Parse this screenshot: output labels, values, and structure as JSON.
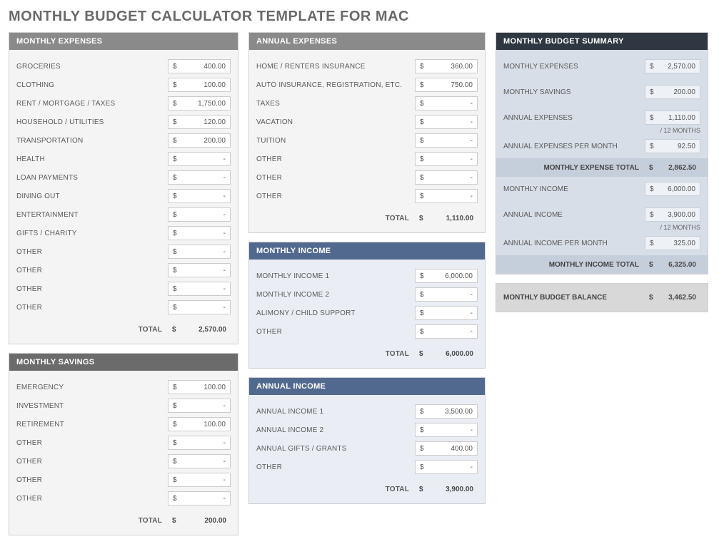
{
  "title": "MONTHLY BUDGET CALCULATOR TEMPLATE FOR MAC",
  "currency": "$",
  "dash": "-",
  "headers": {
    "monthly_expenses": "MONTHLY EXPENSES",
    "monthly_savings": "MONTHLY SAVINGS",
    "annual_expenses": "ANNUAL EXPENSES",
    "monthly_income": "MONTHLY INCOME",
    "annual_income": "ANNUAL INCOME",
    "summary": "MONTHLY BUDGET SUMMARY"
  },
  "total_label": "TOTAL",
  "monthly_expenses": {
    "items": [
      {
        "label": "GROCERIES",
        "value": "400.00"
      },
      {
        "label": "CLOTHING",
        "value": "100.00"
      },
      {
        "label": "RENT / MORTGAGE / TAXES",
        "value": "1,750.00"
      },
      {
        "label": "HOUSEHOLD / UTILITIES",
        "value": "120.00"
      },
      {
        "label": "TRANSPORTATION",
        "value": "200.00"
      },
      {
        "label": "HEALTH",
        "value": "-"
      },
      {
        "label": "LOAN PAYMENTS",
        "value": "-"
      },
      {
        "label": "DINING OUT",
        "value": "-"
      },
      {
        "label": "ENTERTAINMENT",
        "value": "-"
      },
      {
        "label": "GIFTS / CHARITY",
        "value": "-"
      },
      {
        "label": "OTHER",
        "value": "-"
      },
      {
        "label": "OTHER",
        "value": "-"
      },
      {
        "label": "OTHER",
        "value": "-"
      },
      {
        "label": "OTHER",
        "value": "-"
      }
    ],
    "total": "2,570.00"
  },
  "monthly_savings": {
    "items": [
      {
        "label": "EMERGENCY",
        "value": "100.00"
      },
      {
        "label": "INVESTMENT",
        "value": "-"
      },
      {
        "label": "RETIREMENT",
        "value": "100.00"
      },
      {
        "label": "OTHER",
        "value": "-"
      },
      {
        "label": "OTHER",
        "value": "-"
      },
      {
        "label": "OTHER",
        "value": "-"
      },
      {
        "label": "OTHER",
        "value": "-"
      }
    ],
    "total": "200.00"
  },
  "annual_expenses": {
    "items": [
      {
        "label": "HOME / RENTERS INSURANCE",
        "value": "360.00"
      },
      {
        "label": "AUTO INSURANCE, REGISTRATION, ETC.",
        "value": "750.00"
      },
      {
        "label": "TAXES",
        "value": "-"
      },
      {
        "label": "VACATION",
        "value": "-"
      },
      {
        "label": "TUITION",
        "value": "-"
      },
      {
        "label": "OTHER",
        "value": "-"
      },
      {
        "label": "OTHER",
        "value": "-"
      },
      {
        "label": "OTHER",
        "value": "-"
      }
    ],
    "total": "1,110.00"
  },
  "monthly_income": {
    "items": [
      {
        "label": "MONTHLY INCOME 1",
        "value": "6,000.00"
      },
      {
        "label": "MONTHLY INCOME 2",
        "value": "-"
      },
      {
        "label": "ALIMONY / CHILD SUPPORT",
        "value": "-"
      },
      {
        "label": "OTHER",
        "value": "-"
      }
    ],
    "total": "6,000.00"
  },
  "annual_income": {
    "items": [
      {
        "label": "ANNUAL INCOME 1",
        "value": "3,500.00"
      },
      {
        "label": "ANNUAL INCOME 2",
        "value": "-"
      },
      {
        "label": "ANNUAL GIFTS / GRANTS",
        "value": "400.00"
      },
      {
        "label": "OTHER",
        "value": "-"
      }
    ],
    "total": "3,900.00"
  },
  "summary": {
    "monthly_expenses": {
      "label": "MONTHLY EXPENSES",
      "value": "2,570.00"
    },
    "monthly_savings": {
      "label": "MONTHLY SAVINGS",
      "value": "200.00"
    },
    "annual_expenses": {
      "label": "ANNUAL EXPENSES",
      "value": "1,110.00"
    },
    "per_12": "/ 12 MONTHS",
    "annual_expenses_pm": {
      "label": "ANNUAL EXPENSES PER MONTH",
      "value": "92.50"
    },
    "expense_total": {
      "label": "MONTHLY EXPENSE TOTAL",
      "value": "2,862.50"
    },
    "monthly_income": {
      "label": "MONTHLY INCOME",
      "value": "6,000.00"
    },
    "annual_income": {
      "label": "ANNUAL INCOME",
      "value": "3,900.00"
    },
    "annual_income_pm": {
      "label": "ANNUAL INCOME PER MONTH",
      "value": "325.00"
    },
    "income_total": {
      "label": "MONTHLY INCOME TOTAL",
      "value": "6,325.00"
    },
    "balance": {
      "label": "MONTHLY BUDGET BALANCE",
      "value": "3,462.50"
    }
  }
}
